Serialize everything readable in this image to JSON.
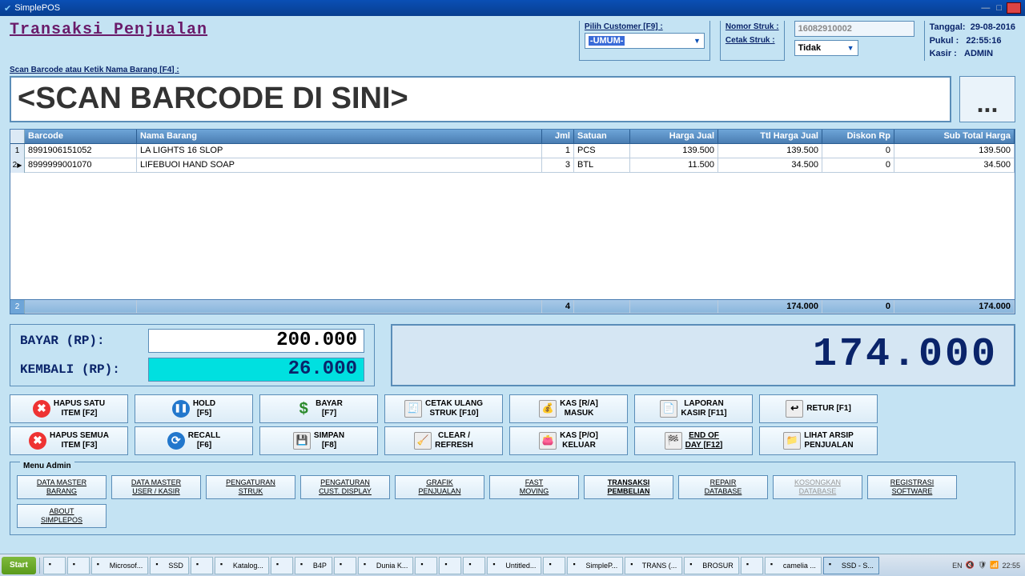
{
  "window": {
    "title": "SimplePOS"
  },
  "page_title": "Transaksi Penjualan",
  "customer": {
    "label": "Pilih Customer [F9] :",
    "value": "-UMUM-"
  },
  "struk": {
    "nomor_label": "Nomor Struk :",
    "nomor_value": "16082910002",
    "cetak_label": "Cetak Struk :",
    "cetak_value": "Tidak"
  },
  "info": {
    "tanggal_label": "Tanggal:",
    "tanggal": "29-08-2016",
    "pukul_label": "Pukul :",
    "pukul": "22:55:16",
    "kasir_label": "Kasir :",
    "kasir": "ADMIN"
  },
  "scan_label": "Scan Barcode atau Ketik Nama Barang [F4] :",
  "scan_placeholder": "<SCAN BARCODE DI SINI>",
  "dots": "...",
  "columns": {
    "barcode": "Barcode",
    "nama": "Nama Barang",
    "jml": "Jml",
    "satuan": "Satuan",
    "harga": "Harga Jual",
    "ttl": "Ttl Harga Jual",
    "diskon": "Diskon Rp",
    "sub": "Sub Total Harga"
  },
  "rows": [
    {
      "idx": "1",
      "barcode": "8991906151052",
      "nama": "LA LIGHTS 16 SLOP",
      "jml": "1",
      "satuan": "PCS",
      "harga": "139.500",
      "ttl": "139.500",
      "diskon": "0",
      "sub": "139.500"
    },
    {
      "idx": "2",
      "barcode": "8999999001070",
      "nama": "LIFEBUOI HAND SOAP",
      "jml": "3",
      "satuan": "BTL",
      "harga": "11.500",
      "ttl": "34.500",
      "diskon": "0",
      "sub": "34.500"
    }
  ],
  "footer": {
    "count": "2",
    "jml": "4",
    "ttl": "174.000",
    "diskon": "0",
    "sub": "174.000"
  },
  "pay": {
    "bayar_label": "BAYAR (RP):",
    "bayar": "200.000",
    "kembali_label": "KEMBALI (RP):",
    "kembali": "26.000",
    "total": "174.000"
  },
  "buttons": {
    "hapus_satu": "HAPUS SATU\nITEM [F2]",
    "hold": "HOLD\n[F5]",
    "bayar": "BAYAR\n[F7]",
    "cetak_ulang": "CETAK ULANG\nSTRUK [F10]",
    "kas_ra": "KAS [R/A]\nMASUK",
    "laporan": "LAPORAN\nKASIR [F11]",
    "retur": "RETUR [F1]",
    "hapus_semua": "HAPUS SEMUA\nITEM [F3]",
    "recall": "RECALL\n[F6]",
    "simpan": "SIMPAN\n[F8]",
    "clear": "CLEAR /\nREFRESH",
    "kas_po": "KAS [P/O]\nKELUAR",
    "eod": "END OF\nDAY [F12]",
    "arsip": "LIHAT ARSIP\nPENJUALAN"
  },
  "admin_legend": "Menu Admin",
  "admin": [
    "DATA MASTER\nBARANG",
    "DATA MASTER\nUSER / KASIR",
    "PENGATURAN\nSTRUK",
    "PENGATURAN\nCUST. DISPLAY",
    "GRAFIK\nPENJUALAN",
    "FAST\nMOVING",
    "TRANSAKSI\nPEMBELIAN",
    "REPAIR\nDATABASE",
    "KOSONGKAN\nDATABASE",
    "REGISTRASI\nSOFTWARE",
    "ABOUT\nSIMPLEPOS"
  ],
  "taskbar": {
    "start": "Start",
    "items": [
      "",
      "",
      "Microsof...",
      "SSD",
      "",
      "Katalog...",
      "",
      "B4P",
      "",
      "Dunia K...",
      "",
      "",
      "",
      "Untitled...",
      "",
      "SimpleP...",
      "TRANS (...",
      "BROSUR",
      "",
      "camelia ...",
      "SSD - S..."
    ],
    "lang": "EN",
    "clock": "22:55"
  }
}
